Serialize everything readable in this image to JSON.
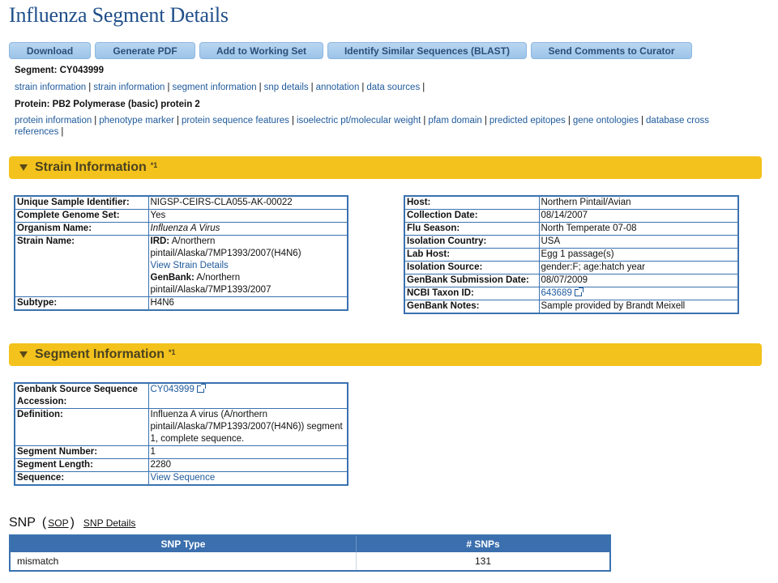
{
  "page": {
    "title": "Influenza Segment Details"
  },
  "toolbar": {
    "download": "Download",
    "generate_pdf": "Generate PDF",
    "add_working_set": "Add to Working Set",
    "blast": "Identify Similar Sequences (BLAST)",
    "send_comments": "Send Comments to Curator"
  },
  "segment_line": {
    "label": "Segment:",
    "value": "CY043999"
  },
  "segment_links": [
    "strain information",
    "strain information",
    "segment information",
    "snp details",
    "annotation",
    "data sources"
  ],
  "protein_line": {
    "label": "Protein:",
    "value": "PB2 Polymerase (basic) protein 2"
  },
  "protein_links": [
    "protein information",
    "phenotype marker",
    "protein sequence features",
    "isoelectric pt/molecular weight",
    "pfam domain",
    "predicted epitopes",
    "gene ontologies",
    "database cross references"
  ],
  "separator": "|",
  "strain_section": {
    "title": "Strain Information",
    "sup": "*1"
  },
  "strain_left": {
    "unique_id_label": "Unique Sample Identifier:",
    "unique_id": "NIGSP-CEIRS-CLA055-AK-00022",
    "complete_genome_label": "Complete Genome Set:",
    "complete_genome": "Yes",
    "organism_label": "Organism Name:",
    "organism": "Influenza A Virus",
    "strain_label": "Strain Name:",
    "ird_label": "IRD:",
    "ird_value": "A/northern pintail/Alaska/7MP1393/2007(H4N6)",
    "view_strain": "View Strain Details",
    "genbank_label": "GenBank:",
    "genbank_value": "A/northern pintail/Alaska/7MP1393/2007",
    "subtype_label": "Subtype:",
    "subtype": "H4N6"
  },
  "strain_right": {
    "host_label": "Host:",
    "host": "Northern Pintail/Avian",
    "collection_label": "Collection Date:",
    "collection": "08/14/2007",
    "flu_season_label": "Flu Season:",
    "flu_season": "North Temperate 07-08",
    "country_label": "Isolation Country:",
    "country": "USA",
    "lab_host_label": "Lab Host:",
    "lab_host": "Egg 1 passage(s)",
    "iso_source_label": "Isolation Source:",
    "iso_source": "gender:F; age:hatch year",
    "submission_label": "GenBank Submission Date:",
    "submission": "08/07/2009",
    "taxon_label": "NCBI Taxon ID:",
    "taxon": "643689",
    "notes_label": "GenBank Notes:",
    "notes": "Sample provided by Brandt Meixell"
  },
  "segment_section": {
    "title": "Segment Information",
    "sup": "*1"
  },
  "segment_table": {
    "accession_label": "Genbank Source Sequence Accession:",
    "accession": "CY043999",
    "definition_label": "Definition:",
    "definition": "Influenza A virus (A/northern pintail/Alaska/7MP1393/2007(H4N6)) segment 1, complete sequence.",
    "seg_number_label": "Segment Number:",
    "seg_number": "1",
    "seg_length_label": "Segment Length:",
    "seg_length": "2280",
    "sequence_label": "Sequence:",
    "sequence": "View Sequence"
  },
  "snp": {
    "title": "SNP",
    "sop": "SOP",
    "details": "SNP Details",
    "col_type": "SNP Type",
    "col_count": "# SNPs",
    "rows": [
      {
        "type": "mismatch",
        "count": "131"
      }
    ]
  }
}
